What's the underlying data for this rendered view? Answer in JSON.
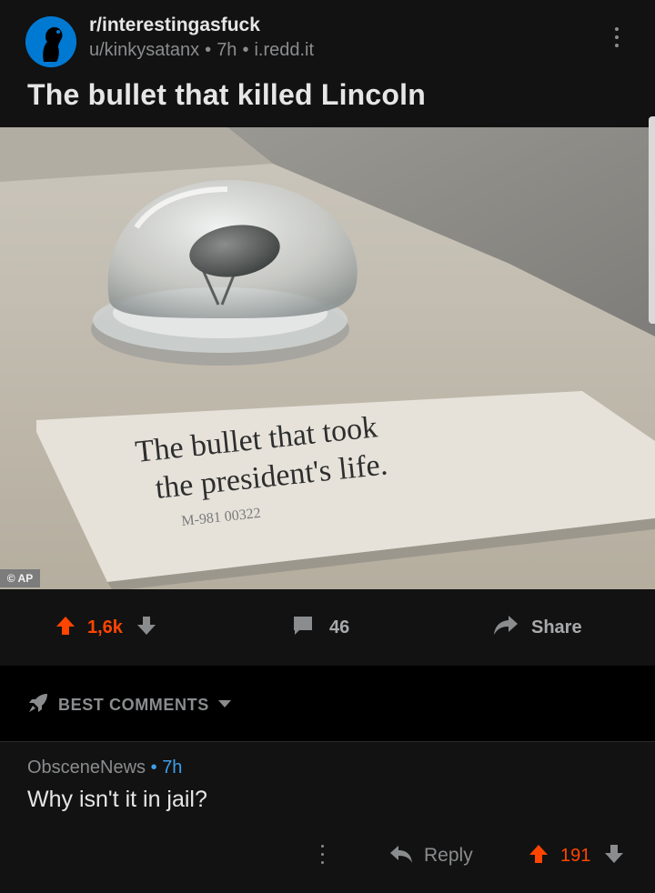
{
  "post": {
    "subreddit": "r/interestingasfuck",
    "author": "u/kinkysatanx",
    "age": "7h",
    "domain": "i.redd.it",
    "title": "The bullet that killed Lincoln"
  },
  "media": {
    "card_line1": "The bullet that took",
    "card_line2": "the president's life.",
    "card_code": "M-981 00322",
    "credit": "© AP"
  },
  "actions": {
    "score": "1,6k",
    "comments": "46",
    "share": "Share"
  },
  "sort": {
    "label": "BEST COMMENTS"
  },
  "comment": {
    "author": "ObsceneNews",
    "age": "7h",
    "body": "Why isn't it in jail?",
    "reply": "Reply",
    "score": "191"
  },
  "colors": {
    "background": "#121212",
    "upvote": "#ff4500",
    "timestamp": "#3f9ee8",
    "muted": "#8a8c8e"
  },
  "icons": {
    "subreddit": "alien-avatar-icon",
    "more": "vertical-dots-icon",
    "upvote": "arrow-up-icon",
    "downvote": "arrow-down-icon",
    "comments": "speech-bubble-icon",
    "share": "share-arrow-icon",
    "sort": "rocket-icon",
    "reply": "reply-arrow-icon"
  }
}
